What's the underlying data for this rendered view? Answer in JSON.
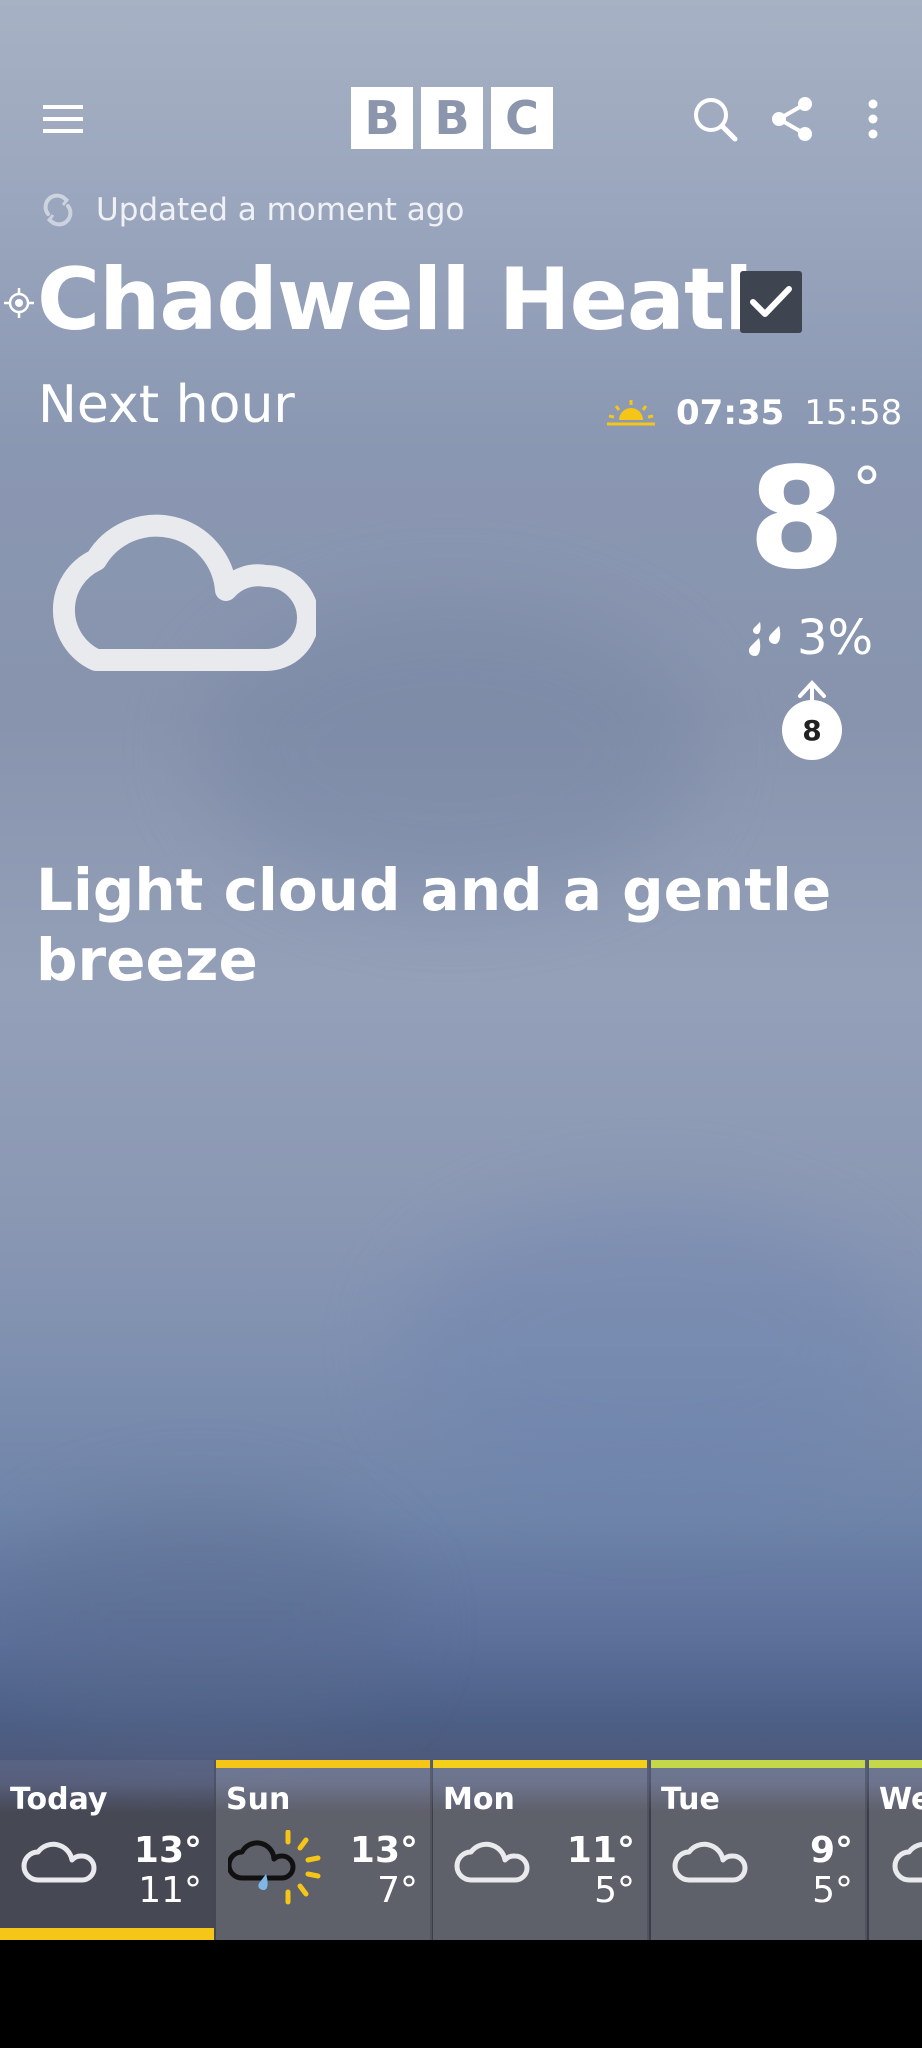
{
  "header": {
    "logo_letters": [
      "B",
      "B",
      "C"
    ],
    "menu_icon": "hamburger-menu-icon",
    "search_icon": "search-icon",
    "share_icon": "share-icon",
    "more_icon": "more-vertical-icon"
  },
  "status": {
    "updated_text": "Updated a moment ago"
  },
  "location": {
    "name": "Chadwell Heath",
    "favourited": true
  },
  "now": {
    "label": "Next hour",
    "sunrise": "07:35",
    "sunset": "15:58",
    "temperature": "8",
    "degree_symbol": "°",
    "rain_chance": "3%",
    "wind_speed": "8",
    "summary": "Light cloud and a gentle breeze"
  },
  "forecast": [
    {
      "day": "Today",
      "high": "13°",
      "low": "11°",
      "icon": "cloud-icon",
      "accent": "#f5c518"
    },
    {
      "day": "Sun",
      "high": "13°",
      "low": "7°",
      "icon": "sunny-intervals-light-rain-icon",
      "accent": "#f5c518"
    },
    {
      "day": "Mon",
      "high": "11°",
      "low": "5°",
      "icon": "cloud-icon",
      "accent": "#f5d018"
    },
    {
      "day": "Tue",
      "high": "9°",
      "low": "5°",
      "icon": "cloud-icon",
      "accent": "#c4d84a"
    },
    {
      "day": "We",
      "high": "",
      "low": "",
      "icon": "cloud-icon",
      "accent": "#c4d84a"
    }
  ],
  "colors": {
    "accent_yellow": "#f5c518",
    "checkbox_bg": "#3e4550"
  }
}
